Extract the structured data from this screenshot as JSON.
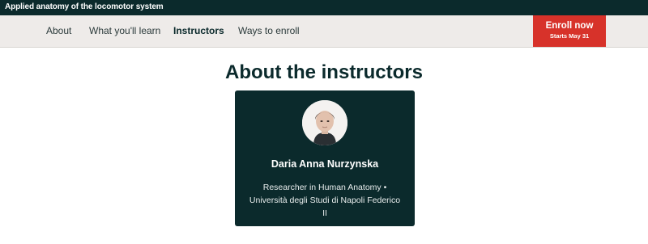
{
  "header": {
    "course_title": "Applied anatomy of the locomotor system"
  },
  "nav": {
    "items": [
      {
        "label": "About"
      },
      {
        "label": "What you'll learn"
      },
      {
        "label": "Instructors"
      },
      {
        "label": "Ways to enroll"
      }
    ],
    "active": "Instructors"
  },
  "enroll": {
    "label": "Enroll now",
    "subtext": "Starts May 31",
    "color": "#d7322a"
  },
  "instructors_section": {
    "title": "About the instructors",
    "instructors": [
      {
        "name": "Daria Anna Nurzynska",
        "bio": "Researcher in Human Anatomy • Università degli Studi di Napoli Federico II",
        "avatar_icon": "person-photo-icon"
      }
    ]
  },
  "colors": {
    "dark": "#0b2a2c",
    "nav_bg": "#eeebe9",
    "accent": "#d7322a"
  }
}
